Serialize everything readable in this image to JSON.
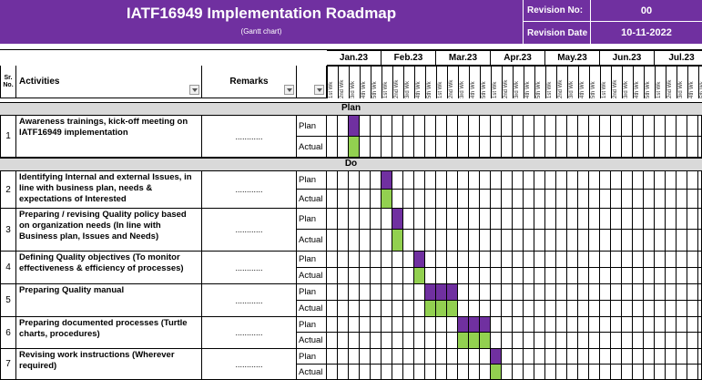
{
  "header": {
    "title": "IATF16949 Implementation Roadmap",
    "subtitle": "(Gantt chart)",
    "revision_no_label": "Revision No:",
    "revision_no": "00",
    "revision_date_label": "Revision Date",
    "revision_date": "10-11-2022"
  },
  "columns": {
    "sr": "Sr. No.",
    "activities": "Activities",
    "remarks": "Remarks"
  },
  "months": [
    "Jan.23",
    "Feb.23",
    "Mar.23",
    "Apr.23",
    "May.23",
    "Jun.23",
    "Jul.23"
  ],
  "weeks": [
    "1st Wk",
    "2nd Wk",
    "3rd Wk",
    "4th Wk",
    "5th Wk"
  ],
  "sections": {
    "plan": "Plan",
    "do": "Do"
  },
  "row_labels": {
    "plan": "Plan",
    "actual": "Actual"
  },
  "colors": {
    "header": "#7030a0",
    "plan": "#7030a0",
    "actual": "#92d050",
    "section": "#d9d9d9"
  },
  "activities": [
    {
      "sr": "1",
      "text": "Awareness trainings, kick-off meeting on IATF16949 implementation",
      "remarks": "............",
      "plan_weeks": [
        2
      ],
      "actual_weeks": [
        2
      ]
    },
    {
      "sr": "2",
      "text": "Identifying Internal and external Issues, in line with business plan, needs & expectations of Interested",
      "remarks": "............",
      "plan_weeks": [
        5
      ],
      "actual_weeks": [
        5
      ]
    },
    {
      "sr": "3",
      "text": "Preparing / revising Quality policy based on organization needs (In line with Business plan, Issues and Needs)",
      "remarks": "............",
      "plan_weeks": [
        6
      ],
      "actual_weeks": [
        6
      ]
    },
    {
      "sr": "4",
      "text": "Defining Quality objectives (To monitor effectiveness & efficiency of processes)",
      "remarks": "............",
      "plan_weeks": [
        8
      ],
      "actual_weeks": [
        8
      ]
    },
    {
      "sr": "5",
      "text": "Preparing Quality manual",
      "remarks": "............",
      "plan_weeks": [
        9,
        10,
        11
      ],
      "actual_weeks": [
        9,
        10,
        11
      ]
    },
    {
      "sr": "6",
      "text": "Preparing documented processes (Turtle charts, procedures)",
      "remarks": "............",
      "plan_weeks": [
        12,
        13,
        14
      ],
      "actual_weeks": [
        12,
        13,
        14
      ]
    },
    {
      "sr": "7",
      "text": "Revising work instructions (Wherever required)",
      "remarks": "............",
      "plan_weeks": [
        15
      ],
      "actual_weeks": [
        15
      ]
    }
  ]
}
